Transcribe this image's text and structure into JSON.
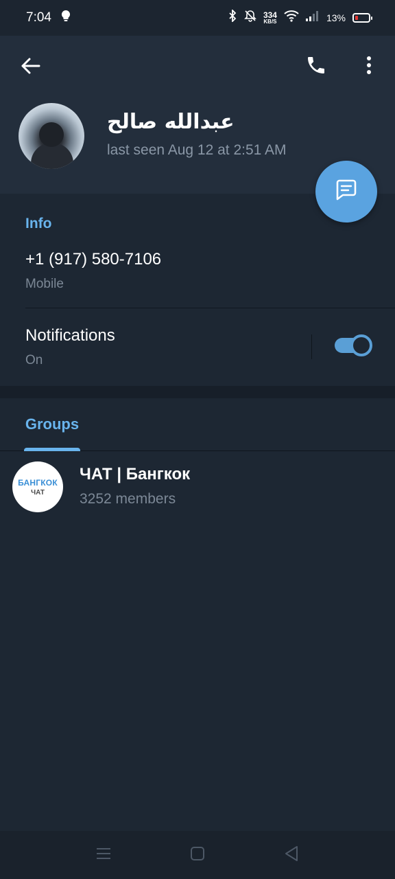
{
  "status_bar": {
    "time": "7:04",
    "net_speed_value": "334",
    "net_speed_unit": "KB/S",
    "battery_percent": "13%",
    "icons": [
      "lightbulb-icon",
      "bluetooth-icon",
      "bell-off-icon",
      "wifi-icon",
      "signal-icon",
      "battery-icon"
    ]
  },
  "header": {
    "contact_name": "عبدالله صالح",
    "last_seen": "last seen Aug 12 at 2:51 AM",
    "icons": [
      "back-arrow-icon",
      "phone-icon",
      "more-vert-icon",
      "message-icon"
    ]
  },
  "info": {
    "section_label": "Info",
    "phone": "+1 (917) 580-7106",
    "phone_type": "Mobile",
    "notifications_label": "Notifications",
    "notifications_value": "On",
    "notifications_enabled": true
  },
  "groups": {
    "tab_label": "Groups",
    "items": [
      {
        "name": "ЧАТ | Бангкок",
        "members": "3252 members",
        "avatar_line1": "БАНГКОК",
        "avatar_line2": "ЧАТ"
      }
    ]
  },
  "nav_bar": {
    "icons": [
      "menu-icon",
      "home-icon",
      "back-icon"
    ]
  },
  "colors": {
    "accent": "#69b4ed",
    "fab": "#5aa3e0",
    "background": "#1d2733",
    "header": "#232e3c"
  }
}
